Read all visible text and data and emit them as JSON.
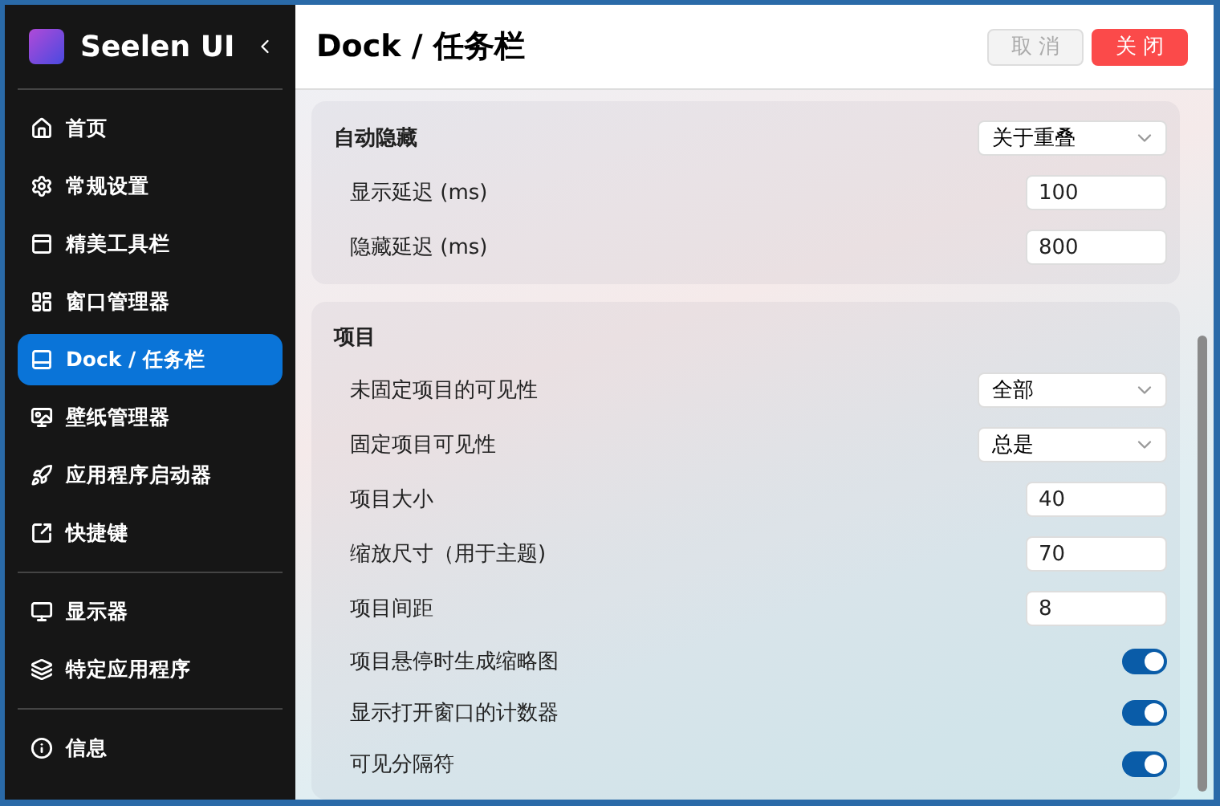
{
  "app": {
    "title": "Seelen UI"
  },
  "nav_groups": [
    [
      {
        "label": "首页",
        "selected": false
      },
      {
        "label": "常规设置",
        "selected": false
      },
      {
        "label": "精美工具栏",
        "selected": false
      },
      {
        "label": "窗口管理器",
        "selected": false
      },
      {
        "label": "Dock / 任务栏",
        "selected": true
      },
      {
        "label": "壁纸管理器",
        "selected": false
      },
      {
        "label": "应用程序启动器",
        "selected": false
      },
      {
        "label": "快捷键",
        "selected": false
      }
    ],
    [
      {
        "label": "显示器",
        "selected": false
      },
      {
        "label": "特定应用程序",
        "selected": false
      }
    ],
    [
      {
        "label": "信息",
        "selected": false
      }
    ]
  ],
  "header": {
    "title": "Dock / 任务栏",
    "buttons": [
      {
        "label": "取 消",
        "kind": "cancel",
        "disabled": true
      },
      {
        "label": "关 闭",
        "kind": "danger",
        "disabled": false
      }
    ]
  },
  "sections": [
    {
      "title": "自动隐藏",
      "title_control": {
        "kind": "select",
        "value": "关于重叠"
      },
      "rows": [
        {
          "kind": "number",
          "label": "显示延迟 (ms)",
          "value": "100"
        },
        {
          "kind": "number",
          "label": "隐藏延迟 (ms)",
          "value": "800"
        }
      ]
    },
    {
      "title": "项目",
      "rows": [
        {
          "kind": "select",
          "label": "未固定项目的可见性",
          "value": "全部"
        },
        {
          "kind": "select",
          "label": "固定项目可见性",
          "value": "总是"
        },
        {
          "kind": "number",
          "label": "项目大小",
          "value": "40"
        },
        {
          "kind": "number",
          "label": "缩放尺寸（用于主题)",
          "value": "70"
        },
        {
          "kind": "number",
          "label": "项目间距",
          "value": "8"
        },
        {
          "kind": "toggle",
          "label": "项目悬停时生成缩略图",
          "on": true
        },
        {
          "kind": "toggle",
          "label": "显示打开窗口的计数器",
          "on": true
        },
        {
          "kind": "toggle",
          "label": "可见分隔符",
          "on": true
        }
      ]
    }
  ]
}
